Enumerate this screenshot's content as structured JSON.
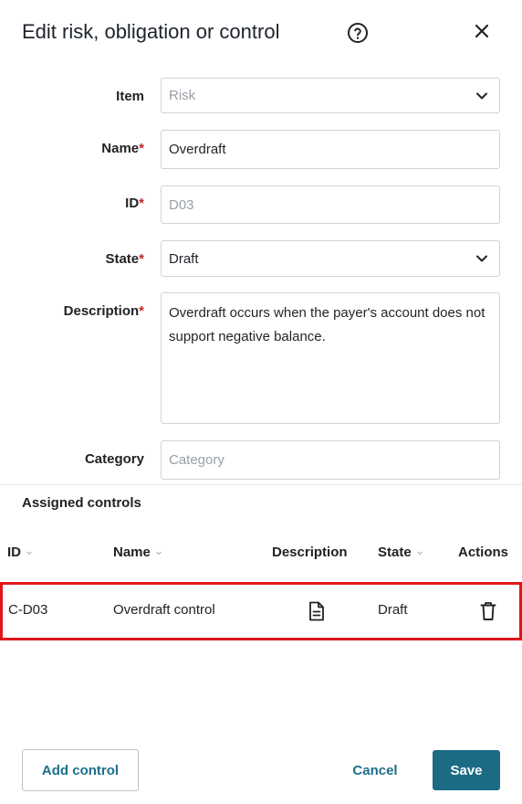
{
  "dialog": {
    "title": "Edit risk, obligation or control"
  },
  "form": {
    "item": {
      "label": "Item",
      "value": "Risk",
      "required": false,
      "value_is_placeholder": true
    },
    "name": {
      "label": "Name",
      "value": "Overdraft",
      "required": true
    },
    "id": {
      "label": "ID",
      "placeholder": "D03",
      "required": true
    },
    "state": {
      "label": "State",
      "value": "Draft",
      "required": true
    },
    "description": {
      "label": "Description",
      "value": "Overdraft occurs when the payer's account does not support negative balance.",
      "required": true
    },
    "category": {
      "label": "Category",
      "placeholder": "Category",
      "required": false
    },
    "required_marker": "*"
  },
  "assigned_controls": {
    "title": "Assigned controls",
    "columns": {
      "id": "ID",
      "name": "Name",
      "description": "Description",
      "state": "State",
      "actions": "Actions"
    },
    "rows": [
      {
        "id": "C-D03",
        "name": "Overdraft control",
        "state": "Draft"
      }
    ]
  },
  "footer": {
    "add_control": "Add control",
    "cancel": "Cancel",
    "save": "Save"
  },
  "colors": {
    "primary": "#1c6b85",
    "required": "#c62828",
    "highlight": "#e0161b"
  },
  "icons": [
    "help-icon",
    "close-icon",
    "chevron-down-icon",
    "sort-icon",
    "document-icon",
    "trash-icon"
  ]
}
